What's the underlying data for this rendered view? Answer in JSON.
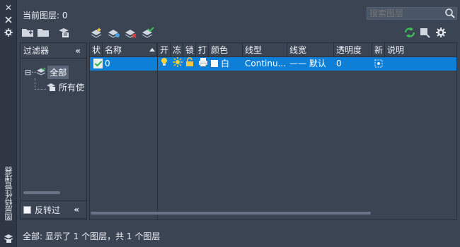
{
  "panel": {
    "vertical_title": "图层特性管理器",
    "current_layer": "当前图层: 0",
    "search_placeholder": "搜索图层"
  },
  "filters": {
    "title": "过滤器",
    "tree_root_prefix": "⊟··",
    "tree_root": "全部",
    "tree_child": "所有使",
    "invert_label": "反转过"
  },
  "grid": {
    "headers": [
      "状",
      "名称",
      "开",
      "冻",
      "锁",
      "打",
      "颜色",
      "线型",
      "线宽",
      "透明度",
      "新",
      "说明"
    ],
    "row": {
      "name": "0",
      "color": "白",
      "linetype": "Continu...",
      "lineweight": "—— 默认",
      "transparency": "0"
    }
  },
  "status": "全部: 显示了 1 个图层，共 1 个图层",
  "colors": {
    "background": "#3b4453",
    "selection": "#0e7fd6",
    "accent_green": "#3fbf5c"
  },
  "icons": [
    "close-icon",
    "autohide-icon",
    "settings-icon",
    "new-filter-icon",
    "group-filter-icon",
    "state-manager-icon",
    "new-layer-icon",
    "new-layer-vp-icon",
    "delete-layer-icon",
    "set-current-icon",
    "refresh-icon",
    "gear-icon",
    "search-icon"
  ]
}
